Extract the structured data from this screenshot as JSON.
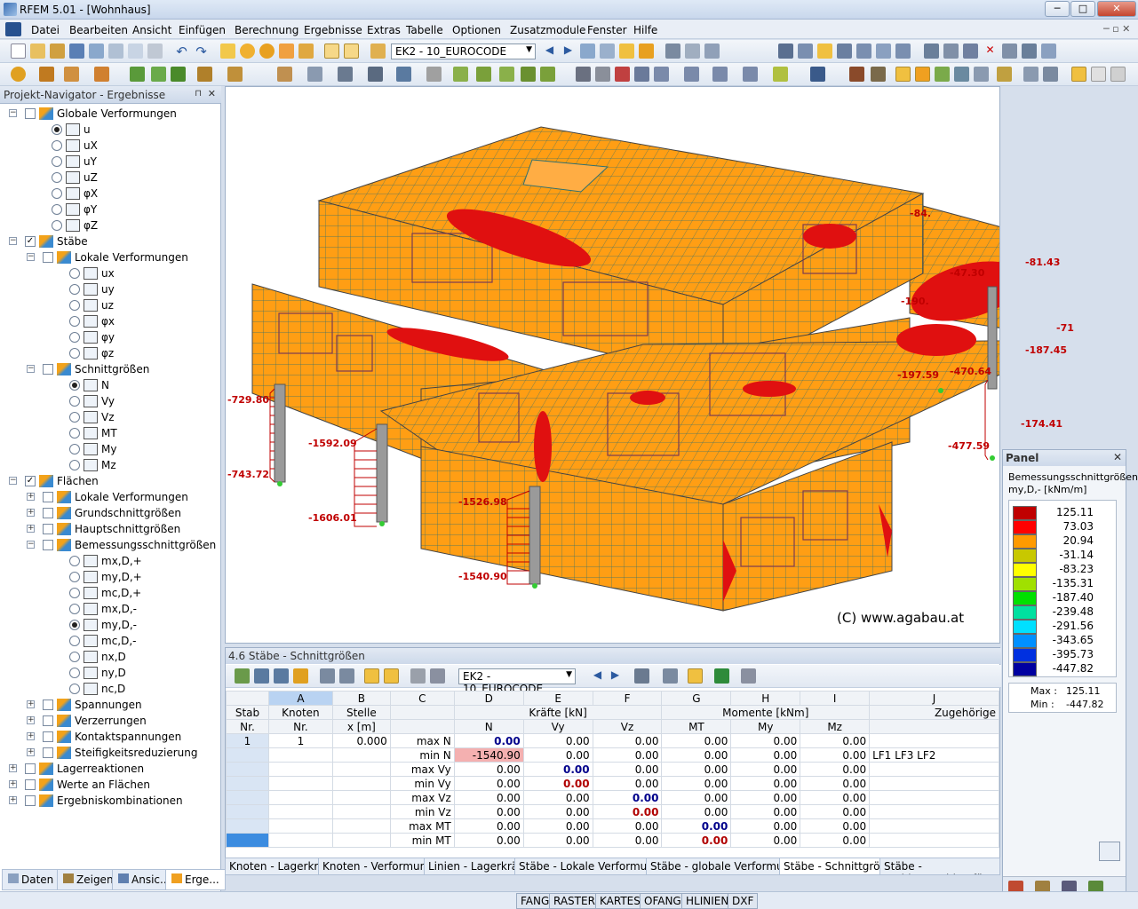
{
  "window": {
    "title": "RFEM 5.01 - [Wohnhaus]",
    "minimize": "─",
    "maximize": "□",
    "close": "✕"
  },
  "menu": [
    "Datei",
    "Bearbeiten",
    "Ansicht",
    "Einfügen",
    "Berechnung",
    "Ergebnisse",
    "Extras",
    "Tabelle",
    "Optionen",
    "Zusatzmodule",
    "Fenster",
    "Hilfe"
  ],
  "toolbar": {
    "loadcase": "EK2 - 10_EUROCODE"
  },
  "navigator": {
    "title": "Projekt-Navigator - Ergebnisse",
    "items": [
      {
        "label": "Globale Verformungen",
        "level": 0,
        "type": "group"
      },
      {
        "label": "u",
        "level": 1,
        "type": "radio",
        "on": true
      },
      {
        "label": "uX",
        "level": 1,
        "type": "radio"
      },
      {
        "label": "uY",
        "level": 1,
        "type": "radio"
      },
      {
        "label": "uZ",
        "level": 1,
        "type": "radio"
      },
      {
        "label": "φX",
        "level": 1,
        "type": "radio"
      },
      {
        "label": "φY",
        "level": 1,
        "type": "radio"
      },
      {
        "label": "φZ",
        "level": 1,
        "type": "radio"
      },
      {
        "label": "Stäbe",
        "level": 0,
        "type": "group",
        "checked": true
      },
      {
        "label": "Lokale Verformungen",
        "level": 1,
        "type": "group"
      },
      {
        "label": "ux",
        "level": 2,
        "type": "radio"
      },
      {
        "label": "uy",
        "level": 2,
        "type": "radio"
      },
      {
        "label": "uz",
        "level": 2,
        "type": "radio"
      },
      {
        "label": "φx",
        "level": 2,
        "type": "radio"
      },
      {
        "label": "φy",
        "level": 2,
        "type": "radio"
      },
      {
        "label": "φz",
        "level": 2,
        "type": "radio"
      },
      {
        "label": "Schnittgrößen",
        "level": 1,
        "type": "group"
      },
      {
        "label": "N",
        "level": 2,
        "type": "radio",
        "on": true
      },
      {
        "label": "Vy",
        "level": 2,
        "type": "radio"
      },
      {
        "label": "Vz",
        "level": 2,
        "type": "radio"
      },
      {
        "label": "MT",
        "level": 2,
        "type": "radio"
      },
      {
        "label": "My",
        "level": 2,
        "type": "radio"
      },
      {
        "label": "Mz",
        "level": 2,
        "type": "radio"
      },
      {
        "label": "Flächen",
        "level": 0,
        "type": "group",
        "checked": true
      },
      {
        "label": "Lokale Verformungen",
        "level": 1,
        "type": "group"
      },
      {
        "label": "Grundschnittgrößen",
        "level": 1,
        "type": "group"
      },
      {
        "label": "Hauptschnittgrößen",
        "level": 1,
        "type": "group"
      },
      {
        "label": "Bemessungsschnittgrößen",
        "level": 1,
        "type": "group"
      },
      {
        "label": "mx,D,+",
        "level": 2,
        "type": "radio"
      },
      {
        "label": "my,D,+",
        "level": 2,
        "type": "radio"
      },
      {
        "label": "mc,D,+",
        "level": 2,
        "type": "radio"
      },
      {
        "label": "mx,D,-",
        "level": 2,
        "type": "radio"
      },
      {
        "label": "my,D,-",
        "level": 2,
        "type": "radio",
        "on": true
      },
      {
        "label": "mc,D,-",
        "level": 2,
        "type": "radio"
      },
      {
        "label": "nx,D",
        "level": 2,
        "type": "radio"
      },
      {
        "label": "ny,D",
        "level": 2,
        "type": "radio"
      },
      {
        "label": "nc,D",
        "level": 2,
        "type": "radio"
      },
      {
        "label": "Spannungen",
        "level": 1,
        "type": "group"
      },
      {
        "label": "Verzerrungen",
        "level": 1,
        "type": "group"
      },
      {
        "label": "Kontaktspannungen",
        "level": 1,
        "type": "group"
      },
      {
        "label": "Steifigkeitsreduzierung",
        "level": 1,
        "type": "group"
      },
      {
        "label": "Lagerreaktionen",
        "level": 0,
        "type": "group"
      },
      {
        "label": "Werte an Flächen",
        "level": 0,
        "type": "group"
      },
      {
        "label": "Ergebniskombinationen",
        "level": 0,
        "type": "group"
      }
    ],
    "tabs": [
      "Daten",
      "Zeigen",
      "Ansic...",
      "Erge..."
    ]
  },
  "view": {
    "copyright": "(C) www.agabau.at",
    "annotations": [
      "-729.80",
      "-743.72",
      "-1592.09",
      "-1606.01",
      "-1526.98",
      "-1540.90",
      "-84.",
      "-47.30",
      "-81.43",
      "-190.",
      "-187.45",
      "-71",
      "-197.59",
      "-470.64",
      "-477.59",
      "-174.41"
    ]
  },
  "table": {
    "title": "4.6 Stäbe - Schnittgrößen",
    "loadcase": "EK2 - 10_EUROCODE",
    "col_letters": [
      "A",
      "B",
      "C",
      "D",
      "E",
      "F",
      "G",
      "H",
      "I",
      "J"
    ],
    "head1": {
      "stab": "Stab",
      "knoten": "Knoten",
      "stelle": "Stelle",
      "kraefte": "Kräfte [kN]",
      "momente": "Momente [kNm]",
      "zug": "Zugehörige"
    },
    "head2": {
      "nr": "Nr.",
      "knr": "Nr.",
      "x": "x [m]",
      "N": "N",
      "Vy": "Vy",
      "Vz": "Vz",
      "MT": "MT",
      "My": "My",
      "Mz": "Mz"
    },
    "rows": [
      {
        "stab": "1",
        "knoten": "1",
        "x": "0.000",
        "label": "max N",
        "N": "0.00",
        "Vy": "0.00",
        "Vz": "0.00",
        "MT": "0.00",
        "My": "0.00",
        "Mz": "0.00",
        "zug": ""
      },
      {
        "stab": "",
        "knoten": "",
        "x": "",
        "label": "min N",
        "N": "-1540.90",
        "Vy": "0.00",
        "Vz": "0.00",
        "MT": "0.00",
        "My": "0.00",
        "Mz": "0.00",
        "zug": "LF1 LF3 LF2"
      },
      {
        "stab": "",
        "knoten": "",
        "x": "",
        "label": "max Vy",
        "N": "0.00",
        "Vy": "0.00",
        "Vz": "0.00",
        "MT": "0.00",
        "My": "0.00",
        "Mz": "0.00",
        "zug": ""
      },
      {
        "stab": "",
        "knoten": "",
        "x": "",
        "label": "min Vy",
        "N": "0.00",
        "Vy": "0.00",
        "Vz": "0.00",
        "MT": "0.00",
        "My": "0.00",
        "Mz": "0.00",
        "zug": ""
      },
      {
        "stab": "",
        "knoten": "",
        "x": "",
        "label": "max Vz",
        "N": "0.00",
        "Vy": "0.00",
        "Vz": "0.00",
        "MT": "0.00",
        "My": "0.00",
        "Mz": "0.00",
        "zug": ""
      },
      {
        "stab": "",
        "knoten": "",
        "x": "",
        "label": "min Vz",
        "N": "0.00",
        "Vy": "0.00",
        "Vz": "0.00",
        "MT": "0.00",
        "My": "0.00",
        "Mz": "0.00",
        "zug": ""
      },
      {
        "stab": "",
        "knoten": "",
        "x": "",
        "label": "max MT",
        "N": "0.00",
        "Vy": "0.00",
        "Vz": "0.00",
        "MT": "0.00",
        "My": "0.00",
        "Mz": "0.00",
        "zug": ""
      },
      {
        "stab": "",
        "knoten": "",
        "x": "",
        "label": "min MT",
        "N": "0.00",
        "Vy": "0.00",
        "Vz": "0.00",
        "MT": "0.00",
        "My": "0.00",
        "Mz": "0.00",
        "zug": ""
      }
    ],
    "tabs": [
      "Knoten - Lagerkräfte",
      "Knoten - Verformungen",
      "Linien - Lagerkräfte",
      "Stäbe - Lokale Verformungen",
      "Stäbe - globale Verformungen",
      "Stäbe - Schnittgrößen",
      "Stäbe - Stabkennzahlen für"
    ]
  },
  "panel": {
    "title": "Panel",
    "heading": "Bemessungsschnittgrößen",
    "unit": "my,D,- [kNm/m]",
    "legend": [
      {
        "value": "125.11",
        "color": "#c00000"
      },
      {
        "value": "73.03",
        "color": "#ff0000"
      },
      {
        "value": "20.94",
        "color": "#ff9a00"
      },
      {
        "value": "-31.14",
        "color": "#c8c800"
      },
      {
        "value": "-83.23",
        "color": "#ffff00"
      },
      {
        "value": "-135.31",
        "color": "#a0e000"
      },
      {
        "value": "-187.40",
        "color": "#00e000"
      },
      {
        "value": "-239.48",
        "color": "#00e0a0"
      },
      {
        "value": "-291.56",
        "color": "#00e0ff"
      },
      {
        "value": "-343.65",
        "color": "#0090ff"
      },
      {
        "value": "-395.73",
        "color": "#0030e0"
      },
      {
        "value": "-447.82",
        "color": "#0000a0"
      }
    ],
    "max_label": "Max :",
    "max": "125.11",
    "min_label": "Min :",
    "min": "-447.82"
  },
  "status": [
    "FANG",
    "RASTER",
    "KARTES",
    "OFANG",
    "HLINIEN",
    "DXF"
  ]
}
